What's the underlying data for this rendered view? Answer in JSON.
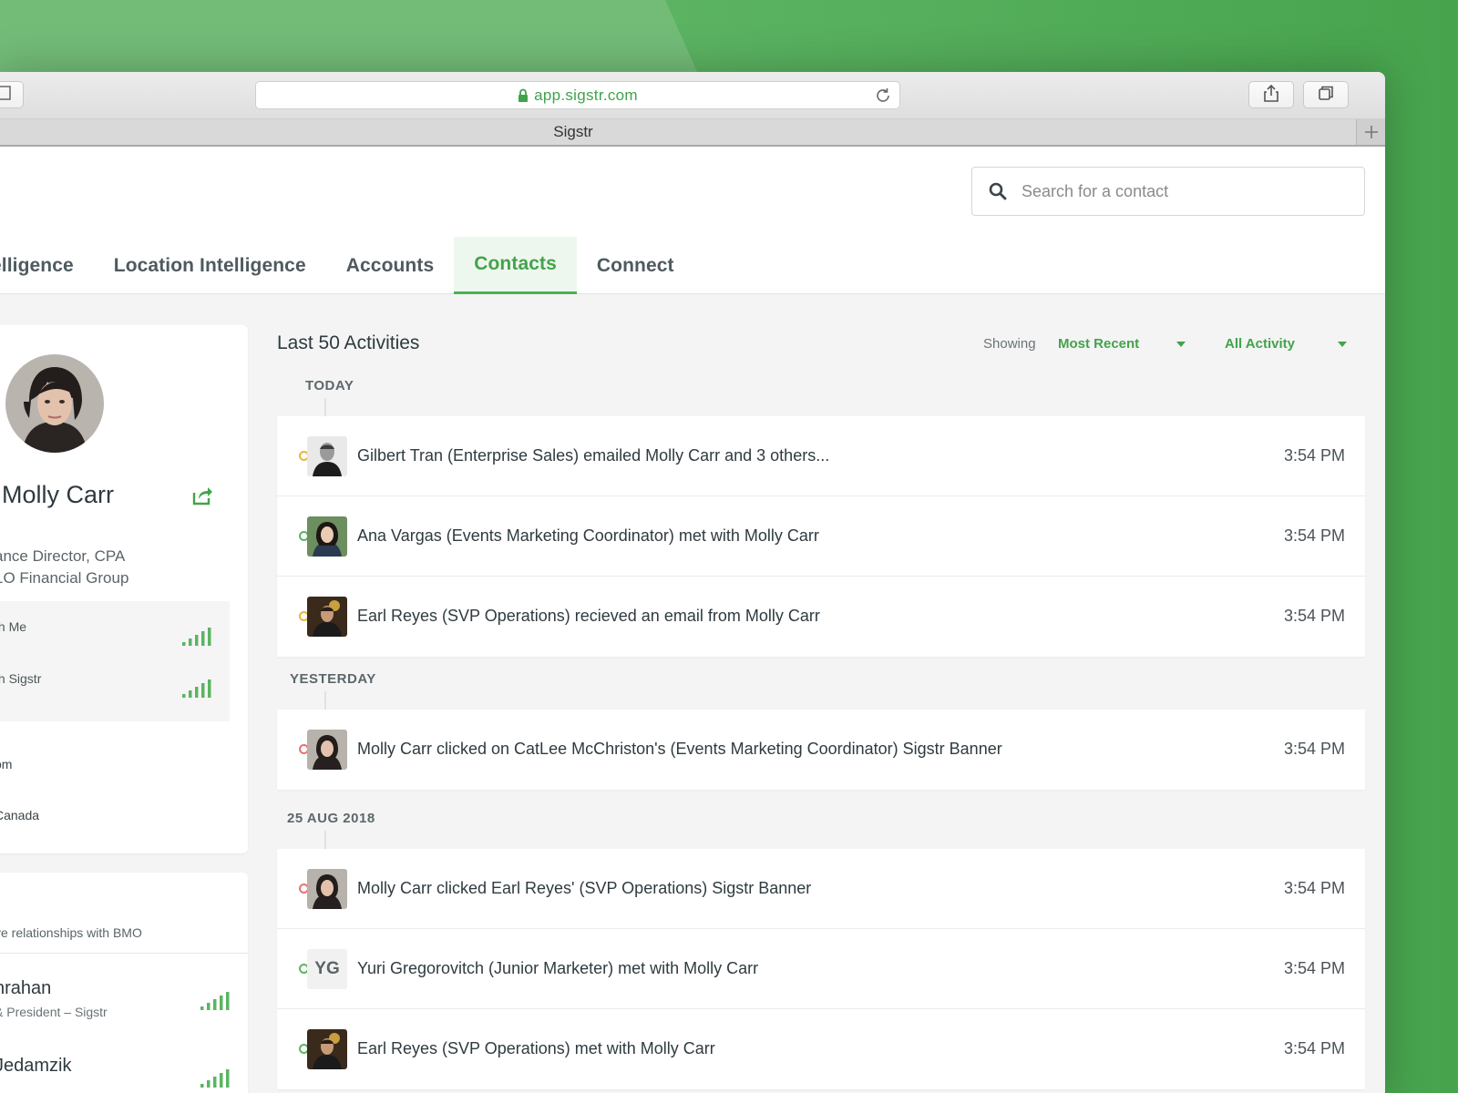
{
  "browser": {
    "url": "app.sigstr.com",
    "tab_title": "Sigstr"
  },
  "search": {
    "placeholder": "Search for a contact"
  },
  "nav": {
    "items": [
      {
        "label": "elligence"
      },
      {
        "label": "Location Intelligence"
      },
      {
        "label": "Accounts"
      },
      {
        "label": "Contacts"
      },
      {
        "label": "Connect"
      }
    ]
  },
  "profile": {
    "name": "Molly Carr",
    "title": "ance Director, CPA",
    "company": "1O Financial Group",
    "relationships": [
      {
        "label": "th Me"
      },
      {
        "label": "th Sigstr"
      }
    ],
    "info": [
      "om",
      "Canada"
    ]
  },
  "relationships_card": {
    "description": "ve relationships with BMO",
    "people": [
      {
        "name": "nrahan",
        "title": "& President – Sigstr"
      },
      {
        "name": "Jedamzik",
        "title": ""
      }
    ]
  },
  "feed": {
    "title": "Last 50 Activities",
    "showing_label": "Showing",
    "sort_value": "Most Recent",
    "filter_value": "All Activity",
    "groups": [
      {
        "label": "TODAY",
        "activities": [
          {
            "text": "Gilbert Tran (Enterprise Sales) emailed Molly Carr  and 3 others...",
            "time": "3:54 PM"
          },
          {
            "text": "Ana Vargas (Events Marketing Coordinator) met with Molly Carr",
            "time": "3:54 PM"
          },
          {
            "text": "Earl Reyes (SVP Operations) recieved an email from Molly Carr",
            "time": "3:54 PM"
          }
        ]
      },
      {
        "label": "YESTERDAY",
        "activities": [
          {
            "text": "Molly Carr clicked on CatLee McChriston's (Events Marketing Coordinator) Sigstr Banner",
            "time": "3:54 PM"
          }
        ]
      },
      {
        "label": "25 AUG 2018",
        "activities": [
          {
            "text": "Molly Carr clicked Earl Reyes' (SVP Operations) Sigstr Banner",
            "time": "3:54 PM"
          },
          {
            "text": "Yuri Gregorovitch (Junior Marketer) met with Molly Carr",
            "time": "3:54 PM",
            "initials": "YG"
          },
          {
            "text": "Earl Reyes (SVP Operations) met with Molly Carr",
            "time": "3:54 PM"
          }
        ]
      }
    ]
  },
  "colors": {
    "accent": "#43a34b",
    "email_dot": "#e8b640",
    "meeting_dot": "#5cb463",
    "click_dot": "#e57373"
  }
}
